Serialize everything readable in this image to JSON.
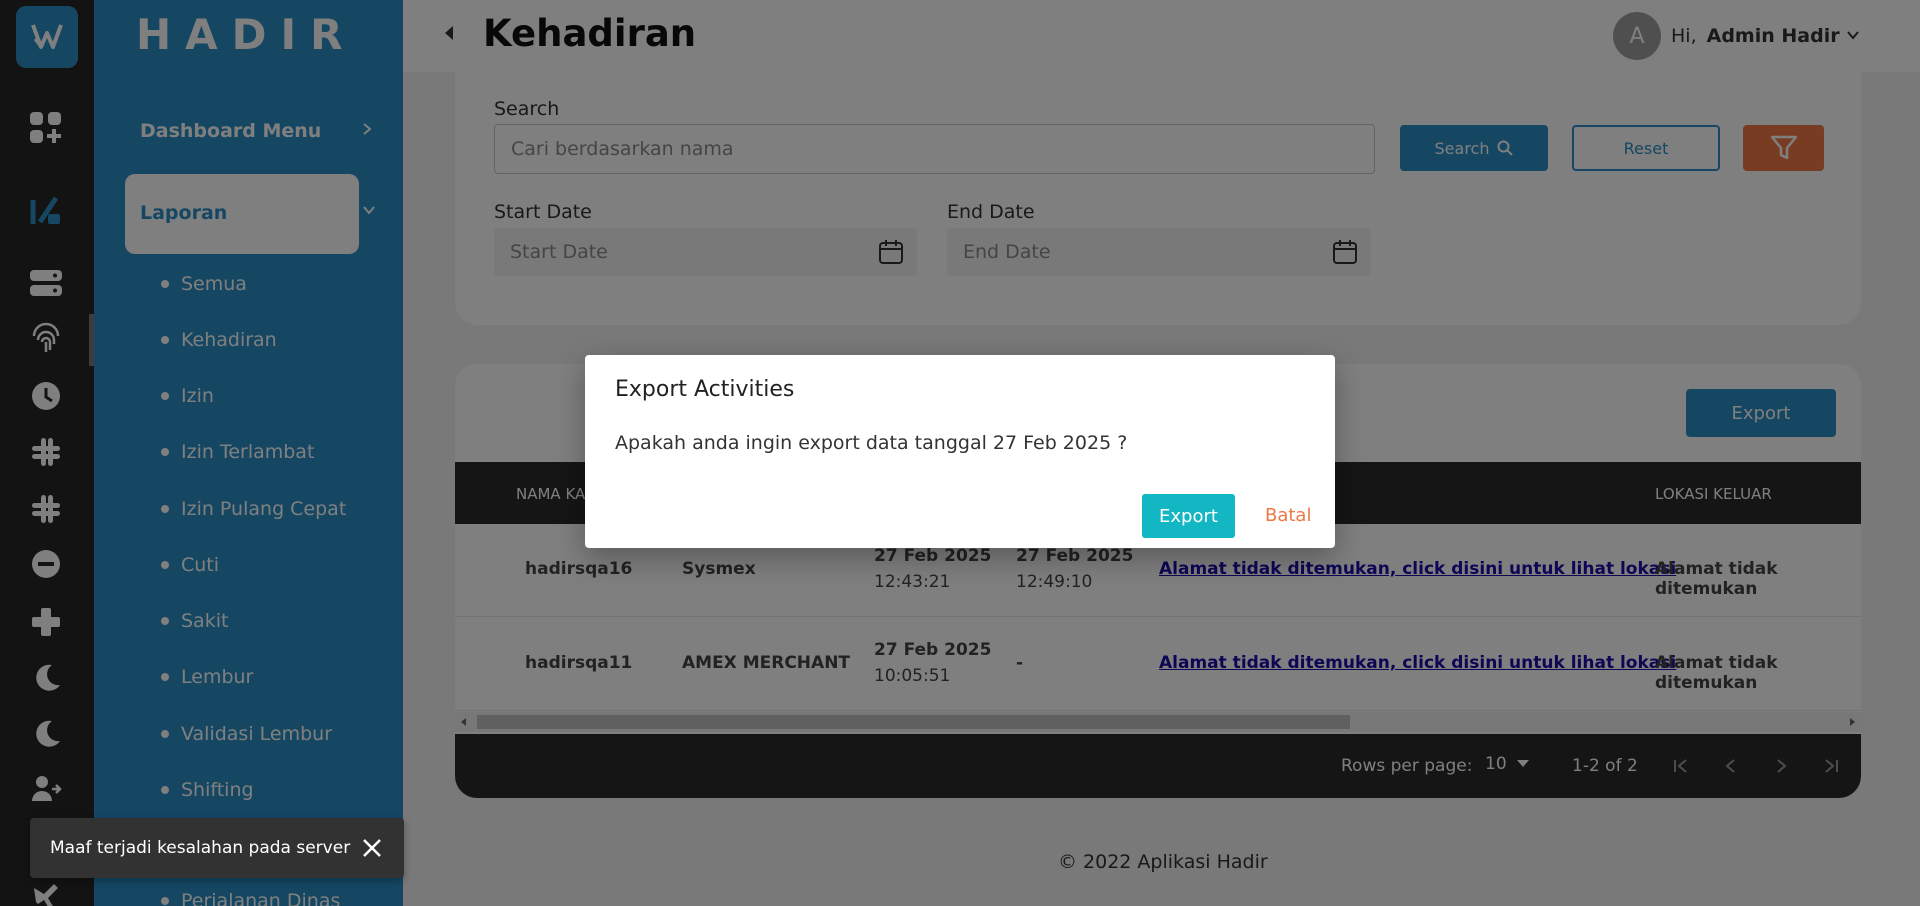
{
  "app": {
    "brand": "HADIR",
    "title": "Kehadiran"
  },
  "user": {
    "avatar_letter": "A",
    "greeting": "Hi,",
    "name": "Admin Hadir"
  },
  "rail_icons": [
    "apps-add-icon",
    "report-icon",
    "server-icon",
    "fingerprint-icon",
    "clock-icon",
    "slack-icon",
    "slack-icon-2",
    "minus-circle-icon",
    "plus-icon",
    "moon-icon",
    "moon-icon-2",
    "user-transfer-icon",
    "plane-icon"
  ],
  "sidebar": {
    "dashboard_label": "Dashboard Menu",
    "active_label": "Laporan",
    "items": [
      {
        "label": "Semua"
      },
      {
        "label": "Kehadiran"
      },
      {
        "label": "Izin"
      },
      {
        "label": "Izin Terlambat"
      },
      {
        "label": "Izin Pulang Cepat"
      },
      {
        "label": "Cuti"
      },
      {
        "label": "Sakit"
      },
      {
        "label": "Lembur"
      },
      {
        "label": "Validasi Lembur"
      },
      {
        "label": "Shifting"
      },
      {
        "label": "Perjalanan Dinas"
      }
    ]
  },
  "filters": {
    "search_label": "Search",
    "search_placeholder": "Cari berdasarkan nama",
    "search_button": "Search",
    "reset_button": "Reset",
    "start_label": "Start Date",
    "start_placeholder": "Start Date",
    "end_label": "End Date",
    "end_placeholder": "End Date"
  },
  "table": {
    "export_button": "Export",
    "headers": {
      "nama": "NAMA KA",
      "lokasi_keluar": "LOKASI KELUAR"
    },
    "rows": [
      {
        "username": "hadirsqa16",
        "company": "Sysmex",
        "in_date": "27 Feb 2025",
        "in_time": "12:43:21",
        "out_date": "27 Feb 2025",
        "out_time": "12:49:10",
        "lokasi_masuk": "Alamat tidak ditemukan, click disini untuk lihat lokasi",
        "lokasi_keluar": "Alamat tidak ditemukan"
      },
      {
        "username": "hadirsqa11",
        "company": "AMEX MERCHANT",
        "in_date": "27 Feb 2025",
        "in_time": "10:05:51",
        "out_date": "-",
        "out_time": "",
        "lokasi_masuk": "Alamat tidak ditemukan, click disini untuk lihat lokasi",
        "lokasi_keluar": "Alamat tidak ditemukan"
      }
    ],
    "rows_per_page_label": "Rows per page:",
    "rows_per_page": "10",
    "range": "1-2 of 2"
  },
  "footer": "© 2022 Aplikasi Hadir",
  "modal": {
    "title": "Export Activities",
    "message": "Apakah anda ingin export data tanggal 27 Feb 2025 ?",
    "confirm": "Export",
    "cancel": "Batal"
  },
  "snackbar": {
    "message": "Maaf terjadi kesalahan pada server"
  },
  "colors": {
    "primary": "#2b8fc7",
    "rail": "#262626",
    "accent_orange": "#f07844",
    "teal": "#13b7c4"
  }
}
